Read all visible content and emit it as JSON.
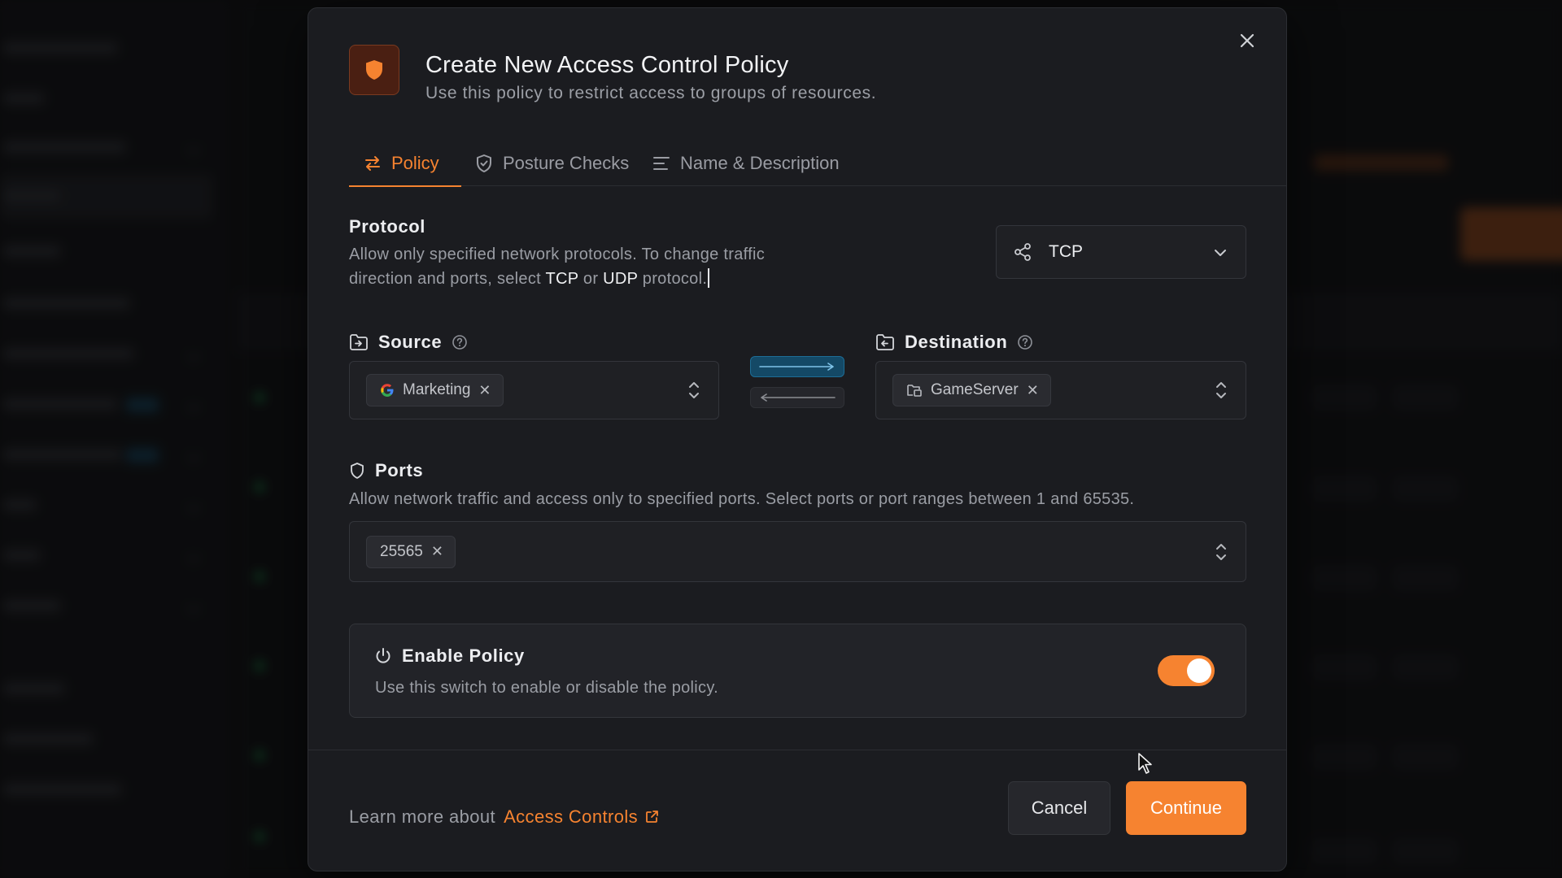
{
  "modal": {
    "title": "Create New Access Control Policy",
    "subtitle": "Use this policy to restrict access to groups of resources."
  },
  "tabs": [
    {
      "label": "Policy",
      "icon": "arrows-swap-icon",
      "active": true
    },
    {
      "label": "Posture Checks",
      "icon": "shield-check-icon",
      "active": false
    },
    {
      "label": "Name & Description",
      "icon": "text-lines-icon",
      "active": false
    }
  ],
  "protocol": {
    "label": "Protocol",
    "desc_line1": "Allow only specified network protocols. To change traffic",
    "desc_line2_pre": "direction and ports, select",
    "tcp": "TCP",
    "or": "or",
    "udp": "UDP",
    "desc_line2_post": "protocol.",
    "selected": "TCP"
  },
  "source": {
    "label": "Source",
    "chip": "Marketing"
  },
  "destination": {
    "label": "Destination",
    "chip": "GameServer"
  },
  "ports": {
    "label": "Ports",
    "desc": "Allow network traffic and access only to specified ports. Select ports or port ranges between 1 and 65535.",
    "chip": "25565"
  },
  "enable": {
    "label": "Enable Policy",
    "desc": "Use this switch to enable or disable the policy.",
    "enabled": true
  },
  "footer": {
    "learn_prefix": "Learn more about",
    "learn_link": "Access Controls",
    "cancel": "Cancel",
    "continue": "Continue"
  },
  "colors": {
    "accent": "#f68330",
    "direction_active": "#144966"
  }
}
